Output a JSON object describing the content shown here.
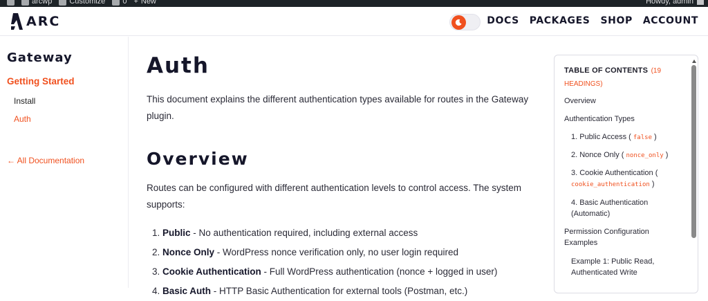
{
  "adminbar": {
    "site_name": "arcwp",
    "customize": "Customize",
    "comments_count": "0",
    "new": "New",
    "greeting": "Howdy, admin"
  },
  "header": {
    "logo_text": "ARC",
    "nav": [
      "DOCS",
      "PACKAGES",
      "SHOP",
      "ACCOUNT"
    ]
  },
  "sidebar": {
    "title": "Gateway",
    "section": "Getting Started",
    "items": [
      "Install",
      "Auth"
    ],
    "all_docs": "← All Documentation"
  },
  "main": {
    "title": "Auth",
    "intro": "This document explains the different authentication types available for routes in the Gateway plugin.",
    "overview_heading": "Overview",
    "overview_text": "Routes can be configured with different authentication levels to control access. The system supports:",
    "list": [
      {
        "num": "1.",
        "bold": "Public",
        "rest": " - No authentication required, including external access"
      },
      {
        "num": "2.",
        "bold": "Nonce Only",
        "rest": " - WordPress nonce verification only, no user login required"
      },
      {
        "num": "3.",
        "bold": "Cookie Authentication",
        "rest": " - Full WordPress authentication (nonce + logged in user)"
      },
      {
        "num": "4.",
        "bold": "Basic Auth",
        "rest": " - HTTP Basic Authentication for external tools (Postman, etc.)"
      }
    ]
  },
  "toc": {
    "title": "TABLE OF CONTENTS",
    "count": "(19 HEADINGS)",
    "items": {
      "overview": "Overview",
      "auth_types": "Authentication Types",
      "public_pre": "1. Public Access (",
      "public_code": "false",
      "public_post": ")",
      "nonce_pre": "2. Nonce Only (",
      "nonce_code": "nonce_only",
      "nonce_post": ")",
      "cookie_pre": "3. Cookie Authentication (",
      "cookie_code": "cookie_authentication",
      "cookie_post": ")",
      "basic": "4. Basic Authentication (Automatic)",
      "perm": "Permission Configuration Examples",
      "example1": "Example 1: Public Read, Authenticated Write"
    }
  },
  "colors": {
    "accent": "#f0501e",
    "heading": "#15162a",
    "adminbar": "#1d2327"
  }
}
